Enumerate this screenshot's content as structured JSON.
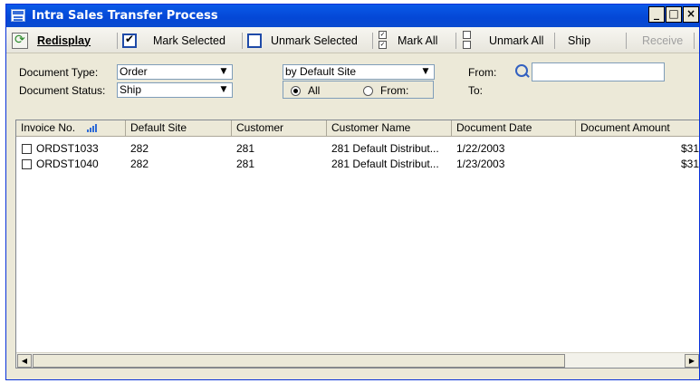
{
  "window": {
    "title": "Intra Sales Transfer Process",
    "controls": [
      "_",
      "□",
      "×"
    ]
  },
  "toolbar": {
    "redisplay": "Redisplay",
    "mark_selected": "Mark Selected",
    "unmark_selected": "Unmark Selected",
    "mark_all": "Mark All",
    "unmark_all": "Unmark All",
    "ship": "Ship",
    "receive": "Receive"
  },
  "filters": {
    "document_type_label": "Document Type:",
    "document_type_value": "Order",
    "document_status_label": "Document Status:",
    "document_status_value": "Ship",
    "sort_by_value": "by Default Site",
    "range_all_label": "All",
    "range_from_label": "From:",
    "from_label": "From:",
    "to_label": "To:",
    "from_value": ""
  },
  "grid": {
    "columns": [
      "Invoice No.",
      "Default Site",
      "Customer",
      "Customer Name",
      "Document Date",
      "Document Amount"
    ],
    "rows": [
      {
        "invoice": "ORDST1033",
        "site": "282",
        "customer": "281",
        "name": "281 Default Distribut...",
        "date": "1/22/2003",
        "amount": "$31"
      },
      {
        "invoice": "ORDST1040",
        "site": "282",
        "customer": "281",
        "name": "281 Default Distribut...",
        "date": "1/23/2003",
        "amount": "$31"
      }
    ]
  },
  "colors": {
    "titlebar": "#0a5ae8",
    "window_bg": "#ece9d8",
    "accent": "#1f4aa8"
  }
}
